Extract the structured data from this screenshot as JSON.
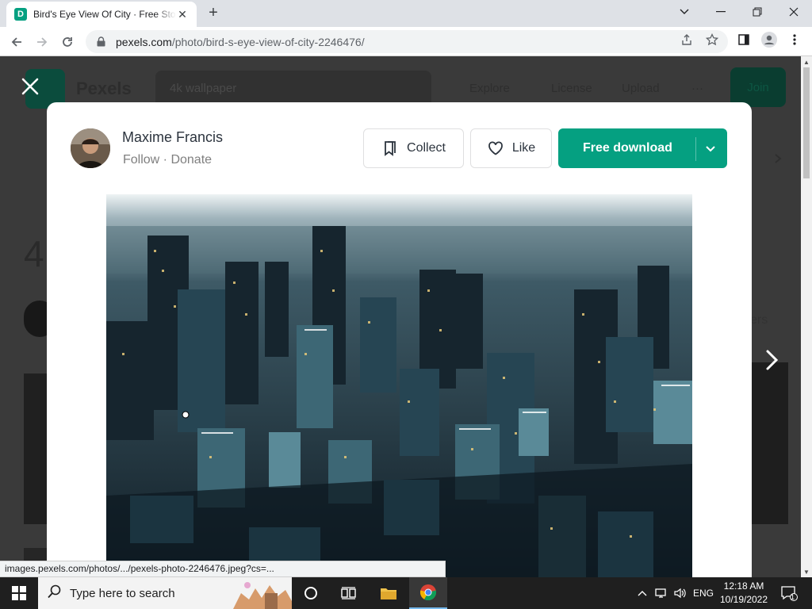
{
  "browser": {
    "tab_title": "Bird's Eye View Of City · Free Stock Photo",
    "favicon_letter": "D",
    "url_host": "pexels.com",
    "url_path": "/photo/bird-s-eye-view-of-city-2246476/",
    "status_url": "images.pexels.com/photos/.../pexels-photo-2246476.jpeg?cs=..."
  },
  "background": {
    "brand": "Pexels",
    "search_placeholder": "4k wallpaper",
    "nav": [
      "Explore",
      "License",
      "Upload"
    ],
    "more": "···",
    "join": "Join",
    "big_text_fragment": "4",
    "side_text_fragment": "ers"
  },
  "modal": {
    "author_name": "Maxime Francis",
    "follow_label": "Follow",
    "separator": " · ",
    "donate_label": "Donate",
    "collect_label": "Collect",
    "like_label": "Like",
    "download_label": "Free download"
  },
  "taskbar": {
    "search_placeholder": "Type here to search",
    "lang": "ENG",
    "time": "12:18 AM",
    "date": "10/19/2022",
    "notification_count": "1"
  },
  "colors": {
    "accent": "#05a081",
    "overlay": "#3a3a3a"
  }
}
